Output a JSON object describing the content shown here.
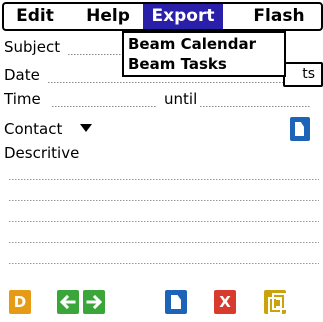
{
  "menubar": {
    "items": [
      {
        "label": "Edit"
      },
      {
        "label": "Help"
      },
      {
        "label": "Export"
      },
      {
        "label": "Flash"
      }
    ]
  },
  "dropdown": {
    "items": [
      {
        "label": "Beam Calendar"
      },
      {
        "label": "Beam Tasks"
      }
    ]
  },
  "form": {
    "subject_label": "Subject",
    "date_label": "Date",
    "date_box_text": "ts",
    "time_label": "Time",
    "until_label": "until",
    "contact_label": "Contact",
    "descriptive_label": "Descritive"
  },
  "toolbar": {
    "d_glyph": "D",
    "delete_glyph": "X"
  },
  "colors": {
    "menu_highlight": "#2a1fa8",
    "blue_icon": "#1d63b8",
    "green_icon": "#3aa63a",
    "orange_icon": "#e79a16",
    "red_icon": "#d93a2e",
    "yellow_icon": "#c9a20c"
  },
  "icons": {
    "new_doc": "document-icon",
    "prev": "arrow-left-icon",
    "next": "arrow-right-icon",
    "note": "notes-icon",
    "delete": "delete-icon",
    "d": "d-icon"
  }
}
